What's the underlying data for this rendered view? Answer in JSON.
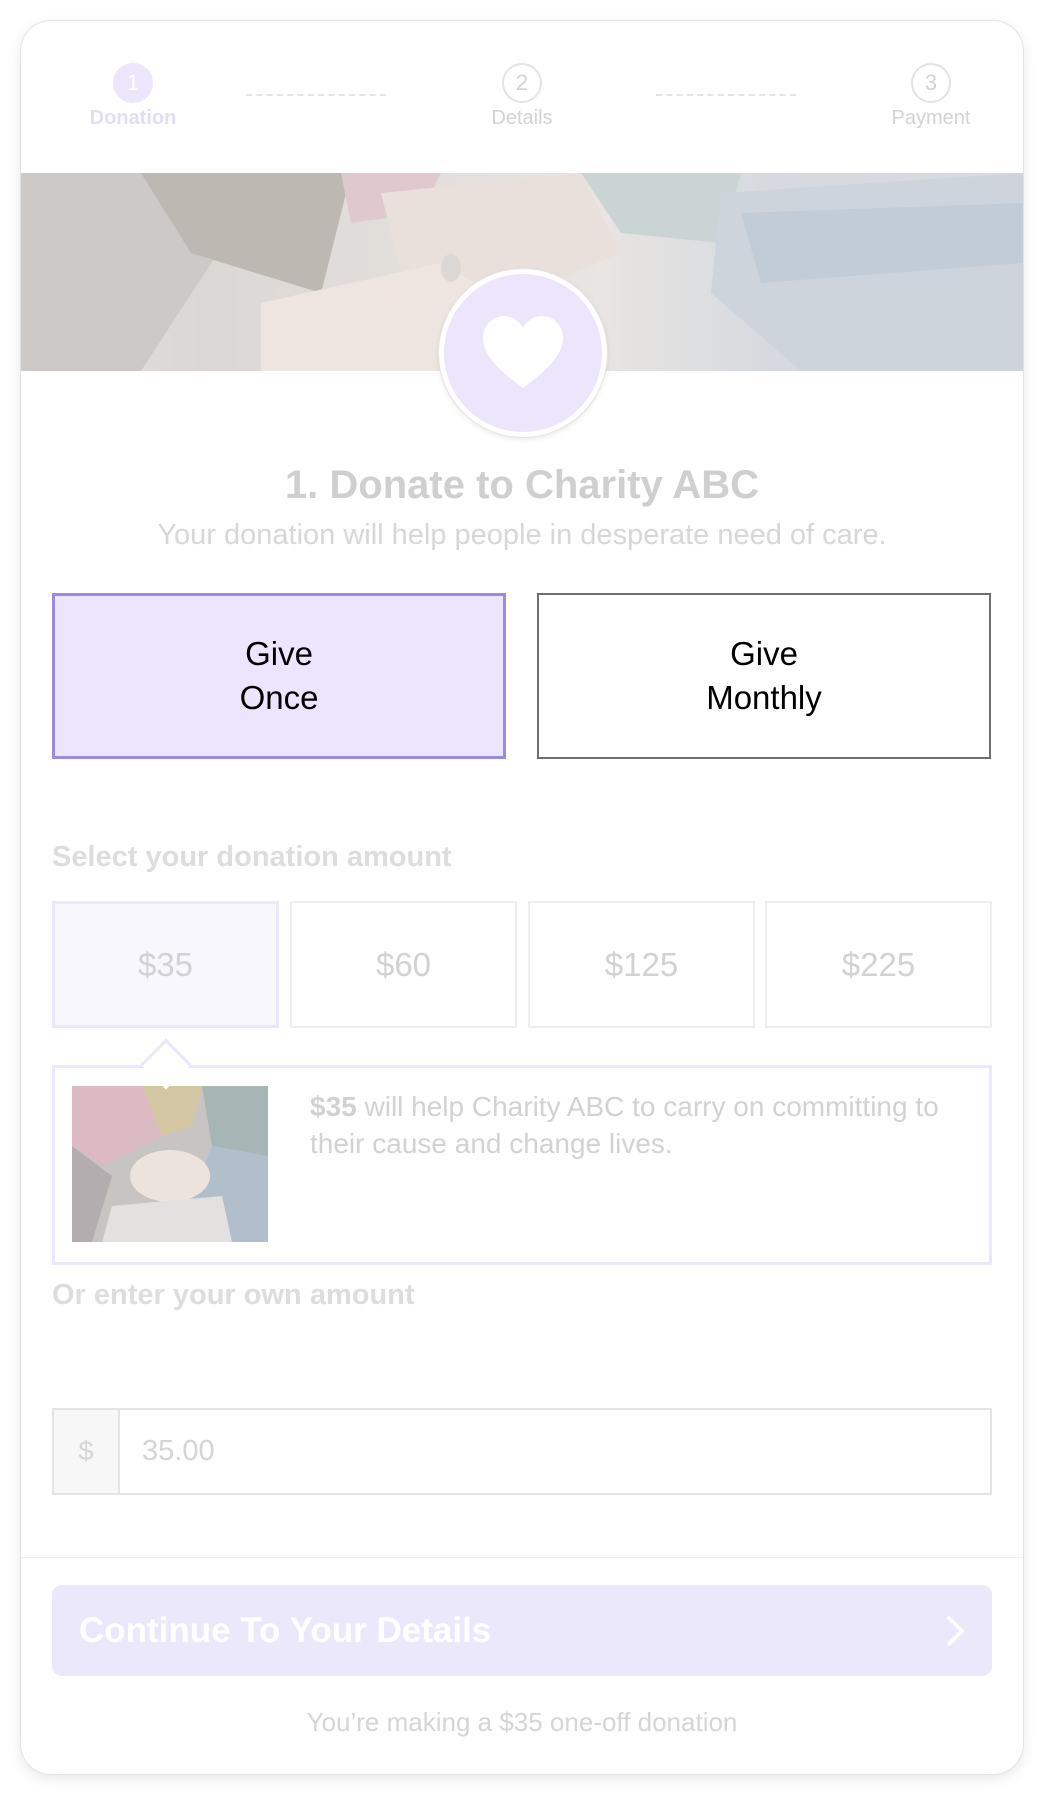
{
  "stepper": {
    "steps": [
      {
        "number": "1",
        "label": "Donation"
      },
      {
        "number": "2",
        "label": "Details"
      },
      {
        "number": "3",
        "label": "Payment"
      }
    ]
  },
  "hero": {
    "image": "hands-together-photo",
    "badge_icon": "heart-icon"
  },
  "header": {
    "title": "1. Donate to Charity ABC",
    "subtitle": "Your donation will help people in desperate need of care."
  },
  "frequency": {
    "once": {
      "line1": "Give",
      "line2": "Once"
    },
    "monthly": {
      "line1": "Give",
      "line2": "Monthly"
    },
    "selected": "once"
  },
  "amounts": {
    "label": "Select your donation amount",
    "options": [
      "$35",
      "$60",
      "$125",
      "$225"
    ],
    "selected_index": 0
  },
  "impact": {
    "amount": "$35",
    "text": " will help Charity ABC to carry on committing to their cause and change lives."
  },
  "custom_amount": {
    "label": "Or enter your own amount",
    "currency": "$",
    "value": "35.00"
  },
  "footer": {
    "continue_label": "Continue To Your Details",
    "summary": "You’re making a $35 one-off donation"
  },
  "colors": {
    "accent": "#9a8be0",
    "accent_light": "#ebe6fd",
    "muted_text": "#d2d2d2"
  }
}
